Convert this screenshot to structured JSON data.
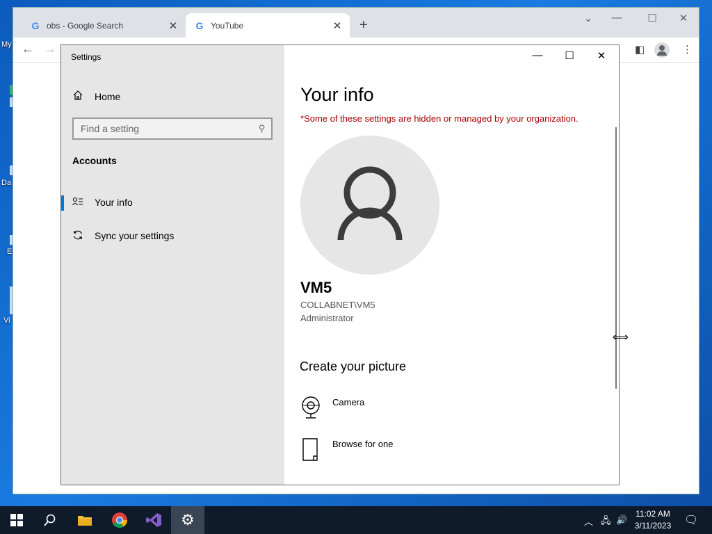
{
  "desktop": {
    "labels": [
      "My",
      "Da",
      "E",
      "Vi"
    ]
  },
  "browser": {
    "tabs": [
      {
        "title": "obs - Google Search",
        "icon": "google-icon"
      },
      {
        "title": "YouTube",
        "icon": "google-icon"
      }
    ],
    "close_glyph": "✕",
    "new_tab_glyph": "+"
  },
  "settings": {
    "app_title": "Settings",
    "sidebar": {
      "home_label": "Home",
      "search_placeholder": "Find a setting",
      "section_heading": "Accounts",
      "items": [
        {
          "label": "Your info",
          "icon": "person-list-icon",
          "active": true
        },
        {
          "label": "Sync your settings",
          "icon": "sync-icon",
          "active": false
        }
      ]
    },
    "main": {
      "title": "Your info",
      "managed_warning": "*Some of these settings are hidden or managed by your organization.",
      "user_name": "VM5",
      "user_domain": "COLLABNET\\VM5",
      "user_role": "Administrator",
      "create_picture_heading": "Create your picture",
      "options": [
        {
          "label": "Camera",
          "icon": "camera-icon"
        },
        {
          "label": "Browse for one",
          "icon": "file-icon"
        }
      ]
    }
  },
  "taskbar": {
    "clock_time": "11:02 AM",
    "clock_date": "3/11/2023",
    "apps": [
      "start-button",
      "search-button",
      "file-explorer",
      "chrome",
      "visual-studio",
      "settings"
    ]
  },
  "colors": {
    "accent": "#0078d7",
    "warning": "#a80000",
    "sidebar_bg": "#e6e6e6",
    "taskbar_bg": "#0f1a2b"
  }
}
